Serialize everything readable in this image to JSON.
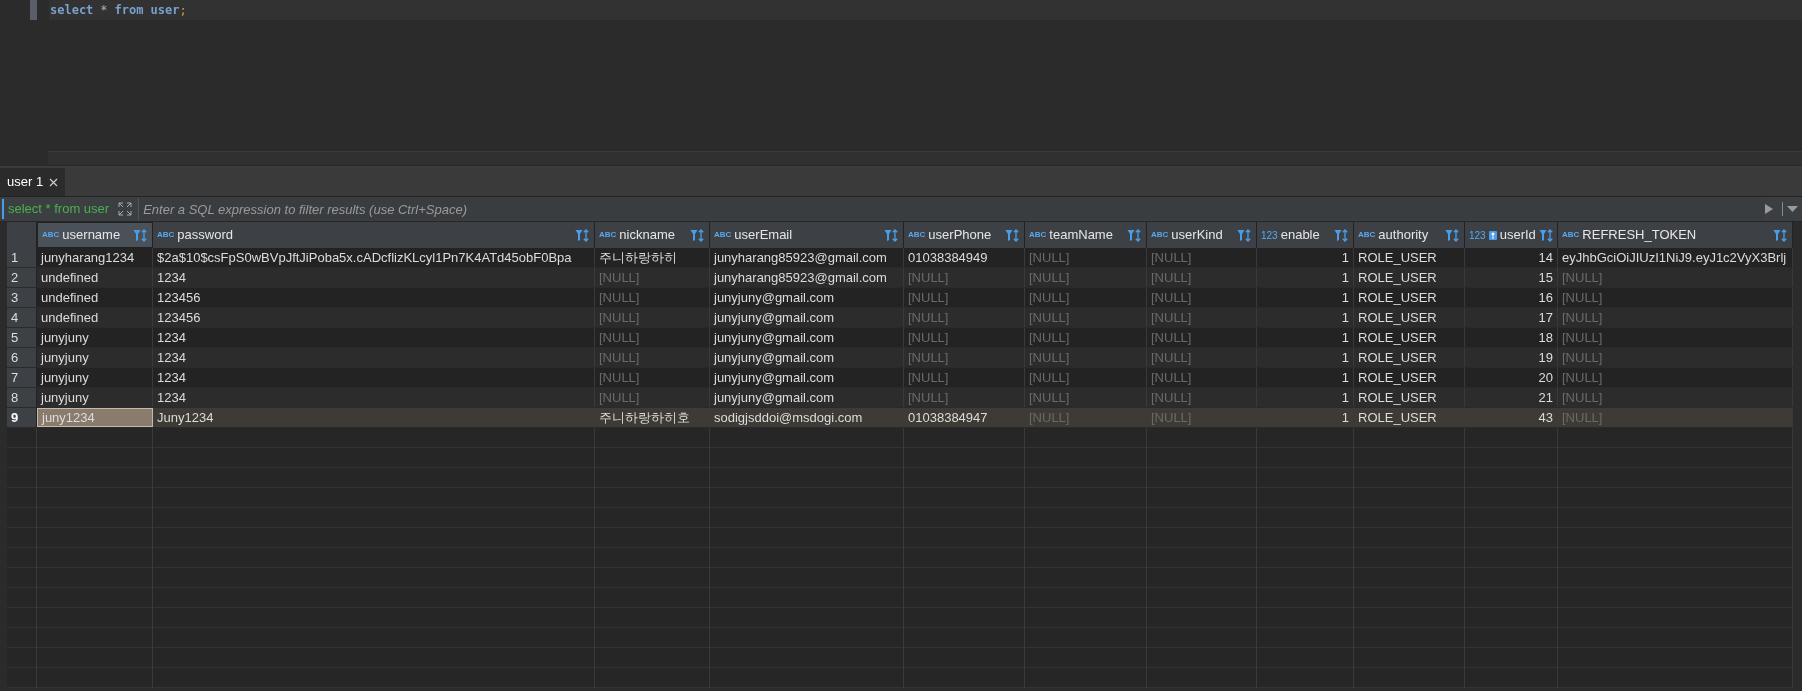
{
  "editor": {
    "lines": [
      [
        {
          "text": "select",
          "kind": "keyword"
        },
        {
          "text": "*",
          "kind": "operator"
        },
        {
          "text": "from",
          "kind": "keyword"
        },
        {
          "text": "user",
          "kind": "keyword"
        },
        {
          "text": ";",
          "kind": "punct"
        }
      ]
    ]
  },
  "result_tabs": [
    {
      "label": "user 1",
      "selected": true
    }
  ],
  "filter_bar": {
    "query": "select * from user",
    "placeholder": "Enter a SQL expression to filter results (use Ctrl+Space)"
  },
  "table": {
    "columns": [
      {
        "name": "username",
        "type_label": "ABC",
        "kind": "text",
        "key": false,
        "selected": true
      },
      {
        "name": "password",
        "type_label": "ABC",
        "kind": "text",
        "key": false,
        "selected": false
      },
      {
        "name": "nickname",
        "type_label": "ABC",
        "kind": "text",
        "key": false,
        "selected": false
      },
      {
        "name": "userEmail",
        "type_label": "ABC",
        "kind": "text",
        "key": false,
        "selected": false
      },
      {
        "name": "userPhone",
        "type_label": "ABC",
        "kind": "text",
        "key": false,
        "selected": false
      },
      {
        "name": "teamName",
        "type_label": "ABC",
        "kind": "text",
        "key": false,
        "selected": false
      },
      {
        "name": "userKind",
        "type_label": "ABC",
        "kind": "text",
        "key": false,
        "selected": false
      },
      {
        "name": "enable",
        "type_label": "123",
        "kind": "number",
        "key": false,
        "selected": false
      },
      {
        "name": "authority",
        "type_label": "ABC",
        "kind": "text",
        "key": false,
        "selected": false
      },
      {
        "name": "userId",
        "type_label": "123",
        "kind": "number",
        "key": true,
        "selected": false
      },
      {
        "name": "REFRESH_TOKEN",
        "type_label": "ABC",
        "kind": "text",
        "key": false,
        "selected": false
      }
    ],
    "rows": [
      {
        "number": "1",
        "selected": false,
        "cells": [
          {
            "v": "junyharang1234",
            "null": false,
            "focused": false
          },
          {
            "v": "$2a$10$csFpS0wBVpJftJiPoba5x.cADcflizKLcyl1Pn7K4ATd45obF0Bpa",
            "null": false,
            "focused": false
          },
          {
            "v": "주니하랑하히",
            "null": false,
            "focused": false
          },
          {
            "v": "junyharang85923@gmail.com",
            "null": false,
            "focused": false
          },
          {
            "v": "01038384949",
            "null": false,
            "focused": false
          },
          {
            "v": "[NULL]",
            "null": true,
            "focused": false
          },
          {
            "v": "[NULL]",
            "null": true,
            "focused": false
          },
          {
            "v": "1",
            "null": false,
            "focused": false
          },
          {
            "v": "ROLE_USER",
            "null": false,
            "focused": false
          },
          {
            "v": "14",
            "null": false,
            "focused": false
          },
          {
            "v": "eyJhbGciOiJIUzI1NiJ9.eyJ1c2VyX3Brlj",
            "null": false,
            "focused": false
          }
        ]
      },
      {
        "number": "2",
        "selected": false,
        "cells": [
          {
            "v": "undefined",
            "null": false,
            "focused": false
          },
          {
            "v": "1234",
            "null": false,
            "focused": false
          },
          {
            "v": "[NULL]",
            "null": true,
            "focused": false
          },
          {
            "v": "junyharang85923@gmail.com",
            "null": false,
            "focused": false
          },
          {
            "v": "[NULL]",
            "null": true,
            "focused": false
          },
          {
            "v": "[NULL]",
            "null": true,
            "focused": false
          },
          {
            "v": "[NULL]",
            "null": true,
            "focused": false
          },
          {
            "v": "1",
            "null": false,
            "focused": false
          },
          {
            "v": "ROLE_USER",
            "null": false,
            "focused": false
          },
          {
            "v": "15",
            "null": false,
            "focused": false
          },
          {
            "v": "[NULL]",
            "null": true,
            "focused": false
          }
        ]
      },
      {
        "number": "3",
        "selected": false,
        "cells": [
          {
            "v": "undefined",
            "null": false,
            "focused": false
          },
          {
            "v": "123456",
            "null": false,
            "focused": false
          },
          {
            "v": "[NULL]",
            "null": true,
            "focused": false
          },
          {
            "v": "junyjuny@gmail.com",
            "null": false,
            "focused": false
          },
          {
            "v": "[NULL]",
            "null": true,
            "focused": false
          },
          {
            "v": "[NULL]",
            "null": true,
            "focused": false
          },
          {
            "v": "[NULL]",
            "null": true,
            "focused": false
          },
          {
            "v": "1",
            "null": false,
            "focused": false
          },
          {
            "v": "ROLE_USER",
            "null": false,
            "focused": false
          },
          {
            "v": "16",
            "null": false,
            "focused": false
          },
          {
            "v": "[NULL]",
            "null": true,
            "focused": false
          }
        ]
      },
      {
        "number": "4",
        "selected": false,
        "cells": [
          {
            "v": "undefined",
            "null": false,
            "focused": false
          },
          {
            "v": "123456",
            "null": false,
            "focused": false
          },
          {
            "v": "[NULL]",
            "null": true,
            "focused": false
          },
          {
            "v": "junyjuny@gmail.com",
            "null": false,
            "focused": false
          },
          {
            "v": "[NULL]",
            "null": true,
            "focused": false
          },
          {
            "v": "[NULL]",
            "null": true,
            "focused": false
          },
          {
            "v": "[NULL]",
            "null": true,
            "focused": false
          },
          {
            "v": "1",
            "null": false,
            "focused": false
          },
          {
            "v": "ROLE_USER",
            "null": false,
            "focused": false
          },
          {
            "v": "17",
            "null": false,
            "focused": false
          },
          {
            "v": "[NULL]",
            "null": true,
            "focused": false
          }
        ]
      },
      {
        "number": "5",
        "selected": false,
        "cells": [
          {
            "v": "junyjuny",
            "null": false,
            "focused": false
          },
          {
            "v": "1234",
            "null": false,
            "focused": false
          },
          {
            "v": "[NULL]",
            "null": true,
            "focused": false
          },
          {
            "v": "junyjuny@gmail.com",
            "null": false,
            "focused": false
          },
          {
            "v": "[NULL]",
            "null": true,
            "focused": false
          },
          {
            "v": "[NULL]",
            "null": true,
            "focused": false
          },
          {
            "v": "[NULL]",
            "null": true,
            "focused": false
          },
          {
            "v": "1",
            "null": false,
            "focused": false
          },
          {
            "v": "ROLE_USER",
            "null": false,
            "focused": false
          },
          {
            "v": "18",
            "null": false,
            "focused": false
          },
          {
            "v": "[NULL]",
            "null": true,
            "focused": false
          }
        ]
      },
      {
        "number": "6",
        "selected": false,
        "cells": [
          {
            "v": "junyjuny",
            "null": false,
            "focused": false
          },
          {
            "v": "1234",
            "null": false,
            "focused": false
          },
          {
            "v": "[NULL]",
            "null": true,
            "focused": false
          },
          {
            "v": "junyjuny@gmail.com",
            "null": false,
            "focused": false
          },
          {
            "v": "[NULL]",
            "null": true,
            "focused": false
          },
          {
            "v": "[NULL]",
            "null": true,
            "focused": false
          },
          {
            "v": "[NULL]",
            "null": true,
            "focused": false
          },
          {
            "v": "1",
            "null": false,
            "focused": false
          },
          {
            "v": "ROLE_USER",
            "null": false,
            "focused": false
          },
          {
            "v": "19",
            "null": false,
            "focused": false
          },
          {
            "v": "[NULL]",
            "null": true,
            "focused": false
          }
        ]
      },
      {
        "number": "7",
        "selected": false,
        "cells": [
          {
            "v": "junyjuny",
            "null": false,
            "focused": false
          },
          {
            "v": "1234",
            "null": false,
            "focused": false
          },
          {
            "v": "[NULL]",
            "null": true,
            "focused": false
          },
          {
            "v": "junyjuny@gmail.com",
            "null": false,
            "focused": false
          },
          {
            "v": "[NULL]",
            "null": true,
            "focused": false
          },
          {
            "v": "[NULL]",
            "null": true,
            "focused": false
          },
          {
            "v": "[NULL]",
            "null": true,
            "focused": false
          },
          {
            "v": "1",
            "null": false,
            "focused": false
          },
          {
            "v": "ROLE_USER",
            "null": false,
            "focused": false
          },
          {
            "v": "20",
            "null": false,
            "focused": false
          },
          {
            "v": "[NULL]",
            "null": true,
            "focused": false
          }
        ]
      },
      {
        "number": "8",
        "selected": false,
        "cells": [
          {
            "v": "junyjuny",
            "null": false,
            "focused": false
          },
          {
            "v": "1234",
            "null": false,
            "focused": false
          },
          {
            "v": "[NULL]",
            "null": true,
            "focused": false
          },
          {
            "v": "junyjuny@gmail.com",
            "null": false,
            "focused": false
          },
          {
            "v": "[NULL]",
            "null": true,
            "focused": false
          },
          {
            "v": "[NULL]",
            "null": true,
            "focused": false
          },
          {
            "v": "[NULL]",
            "null": true,
            "focused": false
          },
          {
            "v": "1",
            "null": false,
            "focused": false
          },
          {
            "v": "ROLE_USER",
            "null": false,
            "focused": false
          },
          {
            "v": "21",
            "null": false,
            "focused": false
          },
          {
            "v": "[NULL]",
            "null": true,
            "focused": false
          }
        ]
      },
      {
        "number": "9",
        "selected": true,
        "cells": [
          {
            "v": "juny1234",
            "null": false,
            "focused": true
          },
          {
            "v": "Juny1234",
            "null": false,
            "focused": false
          },
          {
            "v": "주니하랑하히호",
            "null": false,
            "focused": false
          },
          {
            "v": "sodigjsddoi@msdogi.com",
            "null": false,
            "focused": false
          },
          {
            "v": "01038384947",
            "null": false,
            "focused": false
          },
          {
            "v": "[NULL]",
            "null": true,
            "focused": false
          },
          {
            "v": "[NULL]",
            "null": true,
            "focused": false
          },
          {
            "v": "1",
            "null": false,
            "focused": false
          },
          {
            "v": "ROLE_USER",
            "null": false,
            "focused": false
          },
          {
            "v": "43",
            "null": false,
            "focused": false
          },
          {
            "v": "[NULL]",
            "null": true,
            "focused": false
          }
        ]
      }
    ]
  }
}
